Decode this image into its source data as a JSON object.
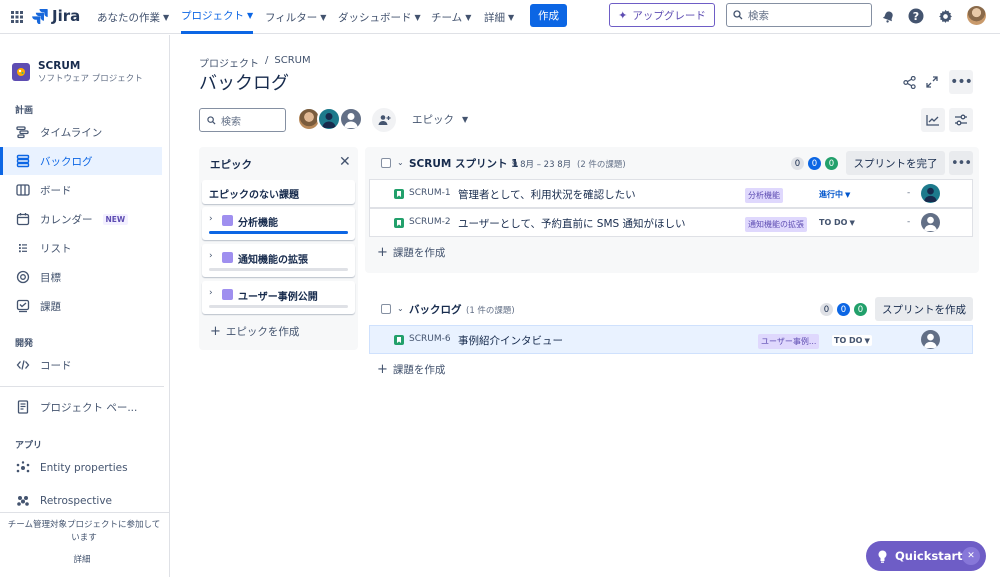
{
  "topnav": {
    "logo": "Jira",
    "items": [
      {
        "label": "あなたの作業"
      },
      {
        "label": "プロジェクト"
      },
      {
        "label": "フィルター"
      },
      {
        "label": "ダッシュボード"
      },
      {
        "label": "チーム"
      },
      {
        "label": "詳細"
      }
    ],
    "create_label": "作成",
    "upgrade_label": "アップグレード",
    "search_placeholder": "検索",
    "accent": "#0c66e4"
  },
  "sidebar": {
    "project_name": "SCRUM",
    "project_type": "ソフトウェア プロジェクト",
    "section_plan": "計画",
    "plan_items": [
      {
        "label": "タイムライン",
        "icon": "timeline-icon"
      },
      {
        "label": "バックログ",
        "icon": "backlog-icon"
      },
      {
        "label": "ボード",
        "icon": "board-icon"
      },
      {
        "label": "カレンダー",
        "icon": "calendar-icon",
        "badge": "NEW"
      },
      {
        "label": "リスト",
        "icon": "list-icon"
      },
      {
        "label": "目標",
        "icon": "goal-icon"
      },
      {
        "label": "課題",
        "icon": "issues-icon"
      }
    ],
    "section_dev": "開発",
    "dev_items": [
      {
        "label": "コード",
        "icon": "code-icon"
      }
    ],
    "project_page": "プロジェクト ペー...",
    "section_apps": "アプリ",
    "app_items": [
      {
        "label": "Entity properties"
      },
      {
        "label": "Retrospective"
      }
    ],
    "footer_text": "チーム管理対象プロジェクトに参加しています",
    "footer_link": "詳細"
  },
  "main": {
    "breadcrumb": {
      "parent": "プロジェクト",
      "separator": "/",
      "current": "SCRUM"
    },
    "title": "バックログ",
    "search_placeholder": "検索",
    "epic_filter_label": "エピック"
  },
  "epic_panel": {
    "title": "エピック",
    "no_epic": "エピックのない課題",
    "epics": [
      {
        "name": "分析機能",
        "progress": 1.0
      },
      {
        "name": "通知機能の拡張",
        "progress": 0
      },
      {
        "name": "ユーザー事例公開",
        "progress": 0
      }
    ],
    "create_label": "エピックを作成"
  },
  "sprint": {
    "name": "SCRUM スプリント 1",
    "dates": "9 8月 – 23 8月",
    "count": "(2 件の課題)",
    "counts": [
      "0",
      "0",
      "0"
    ],
    "complete_label": "スプリントを完了",
    "issues": [
      {
        "key": "SCRUM-1",
        "summary": "管理者として、利用状況を確認したい",
        "epic": "分析機能",
        "status": "進行中",
        "estimate": "-"
      },
      {
        "key": "SCRUM-2",
        "summary": "ユーザーとして、予約直前に SMS 通知がほしい",
        "epic": "通知機能の拡張",
        "status": "TO DO",
        "estimate": "-"
      }
    ],
    "create_issue": "課題を作成"
  },
  "backlog": {
    "name": "バックログ",
    "count": "(1 件の課題)",
    "counts": [
      "0",
      "0",
      "0"
    ],
    "create_sprint": "スプリントを作成",
    "issues": [
      {
        "key": "SCRUM-6",
        "summary": "事例紹介インタビュー",
        "epic": "ユーザー事例...",
        "status": "TO DO"
      }
    ],
    "create_issue": "課題を作成"
  },
  "quickstart": {
    "label": "Quickstart"
  }
}
